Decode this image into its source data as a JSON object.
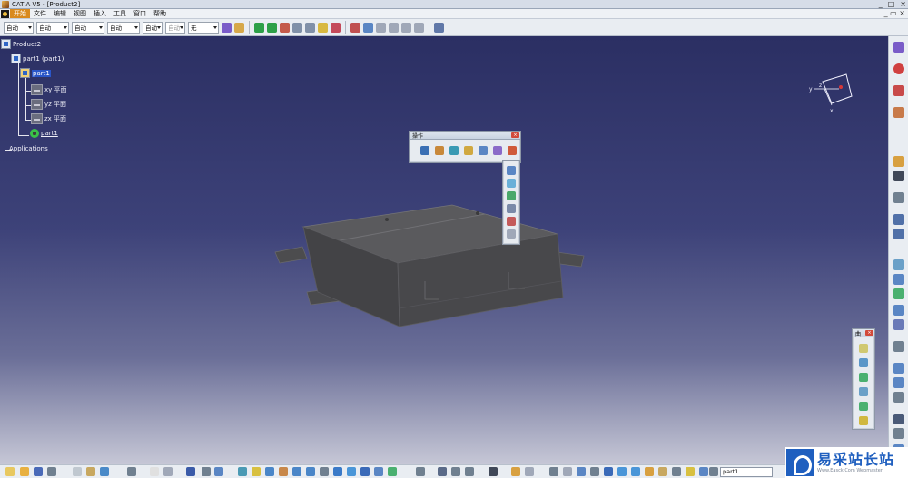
{
  "window": {
    "title": "CATIA V5 - [Product2]",
    "controls": [
      "_",
      "□",
      "×"
    ]
  },
  "menubar": {
    "items": [
      "开始",
      "文件",
      "编辑",
      "视图",
      "插入",
      "工具",
      "窗口",
      "帮助"
    ],
    "active_index": 0,
    "right_controls": "_ ▭ ×"
  },
  "toolbar": {
    "combos": [
      {
        "value": "自动"
      },
      {
        "value": "自动"
      },
      {
        "value": "自动"
      },
      {
        "value": "自动"
      },
      {
        "value": "自动"
      },
      {
        "value": "自动"
      },
      {
        "value": "无"
      }
    ]
  },
  "tree": {
    "root": "Product2",
    "part_instance": "part1 (part1)",
    "part": "part1",
    "planes": [
      "xy 平面",
      "yz 平面",
      "zx 平面"
    ],
    "body": "part1",
    "applications": "Applications"
  },
  "compass": {
    "axes": {
      "x": "x",
      "y": "y",
      "z": "z"
    }
  },
  "operations_toolbar": {
    "title": "操作",
    "close": "×"
  },
  "small_toolbar": {
    "title": "曲",
    "close": "×"
  },
  "bottom": {
    "command_input": "part1"
  },
  "watermark": {
    "main": "易采站长站",
    "sub": "Www.Easck.Com Webmaster"
  },
  "colors": {
    "viewport_top": "#2b2f63",
    "viewport_bottom": "#c6c7d6",
    "selection": "#2a56c8",
    "active_menu": "#d98a1e",
    "model": "#4a4a4c"
  }
}
